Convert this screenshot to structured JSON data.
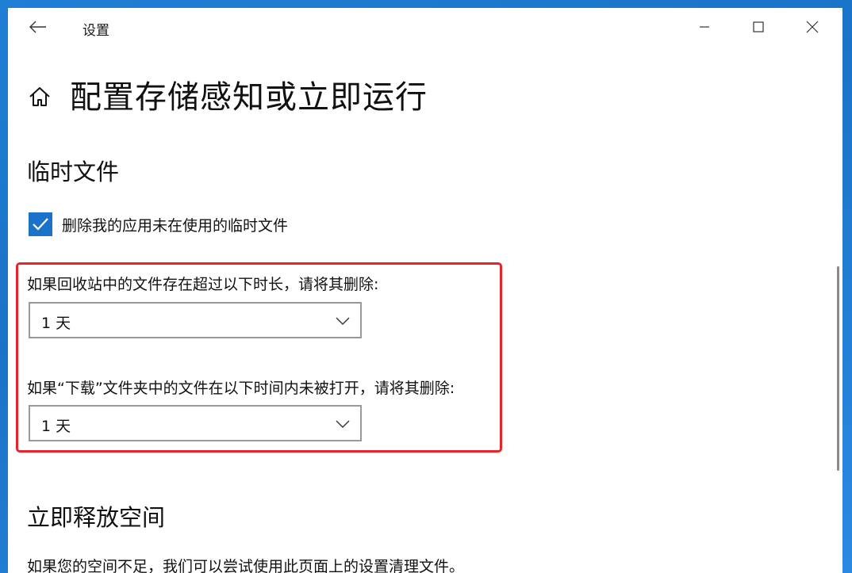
{
  "window": {
    "title": "设置"
  },
  "page": {
    "title": "配置存储感知或立即运行"
  },
  "temp_files": {
    "heading": "临时文件",
    "checkbox_label": "删除我的应用未在使用的临时文件",
    "checkbox_checked": true,
    "recycle_bin": {
      "label": "如果回收站中的文件存在超过以下时长，请将其删除:",
      "value": "1 天"
    },
    "downloads": {
      "label": "如果“下载”文件夹中的文件在以下时间内未被打开，请将其删除:",
      "value": "1 天"
    }
  },
  "free_now": {
    "heading": "立即释放空间",
    "description": "如果您的空间不足，我们可以尝试使用此页面上的设置清理文件。"
  },
  "colors": {
    "accent": "#1a73c8",
    "highlight_border": "#e8232a"
  },
  "icons": {
    "back": "back-arrow-icon",
    "home": "home-icon",
    "minimize": "minimize-icon",
    "maximize": "maximize-icon",
    "close": "close-icon",
    "checkmark": "checkmark-icon",
    "dropdown": "chevron-down-icon"
  }
}
